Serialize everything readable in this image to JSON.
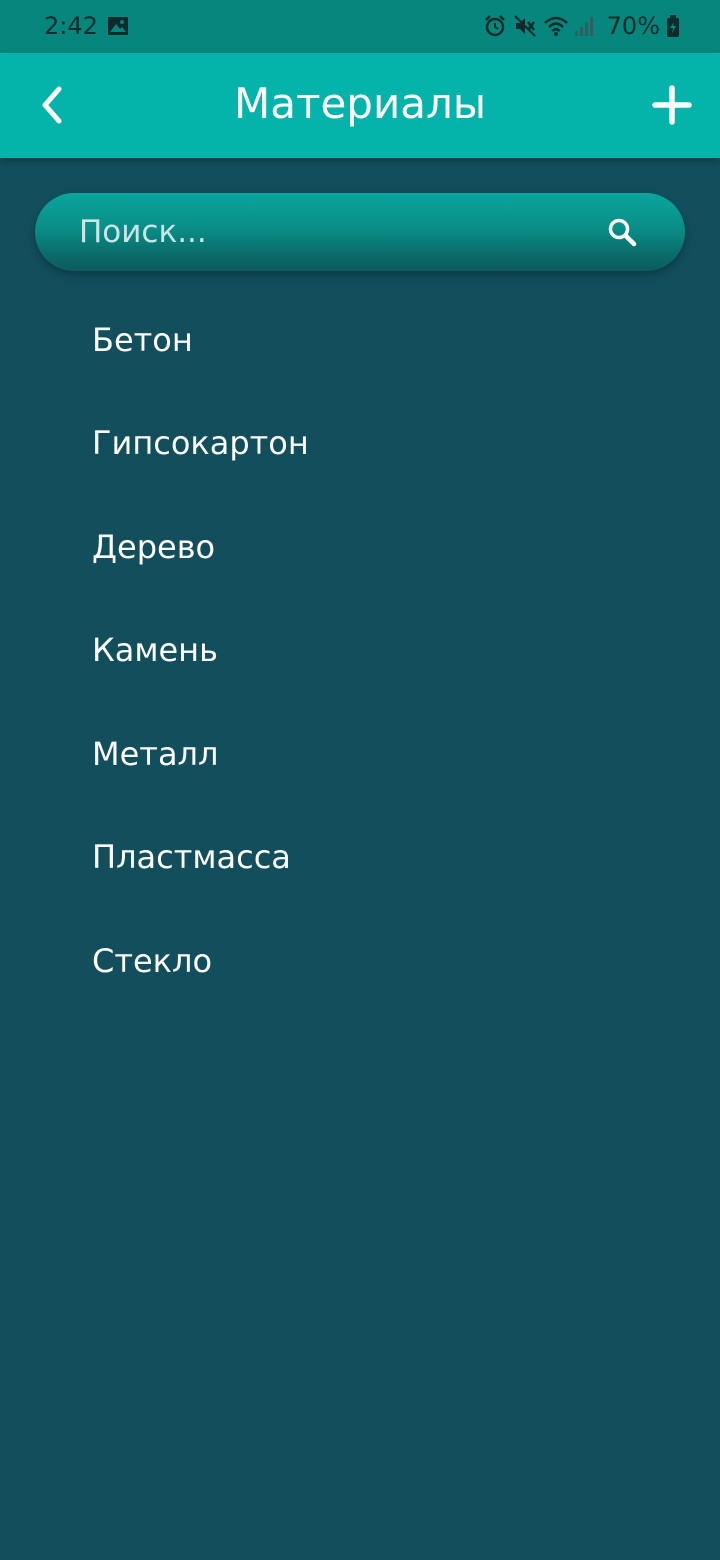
{
  "status_bar": {
    "time": "2:42",
    "battery": "70%",
    "icons": [
      "image-icon",
      "alarm-icon",
      "mute-icon",
      "wifi-icon",
      "signal-icon",
      "battery-icon"
    ]
  },
  "app_bar": {
    "title": "Материалы",
    "back_icon": "chevron-left-icon",
    "add_icon": "plus-icon"
  },
  "search": {
    "placeholder": "Поиск...",
    "value": "",
    "icon": "search-icon"
  },
  "materials": [
    {
      "label": "Бетон"
    },
    {
      "label": "Гипсокартон"
    },
    {
      "label": "Дерево"
    },
    {
      "label": "Камень"
    },
    {
      "label": "Металл"
    },
    {
      "label": "Пластмасса"
    },
    {
      "label": "Стекло"
    }
  ],
  "colors": {
    "status_bar": "#06867c",
    "app_bar": "#04b4ab",
    "background": "#124e5c",
    "text": "#ffffff"
  }
}
